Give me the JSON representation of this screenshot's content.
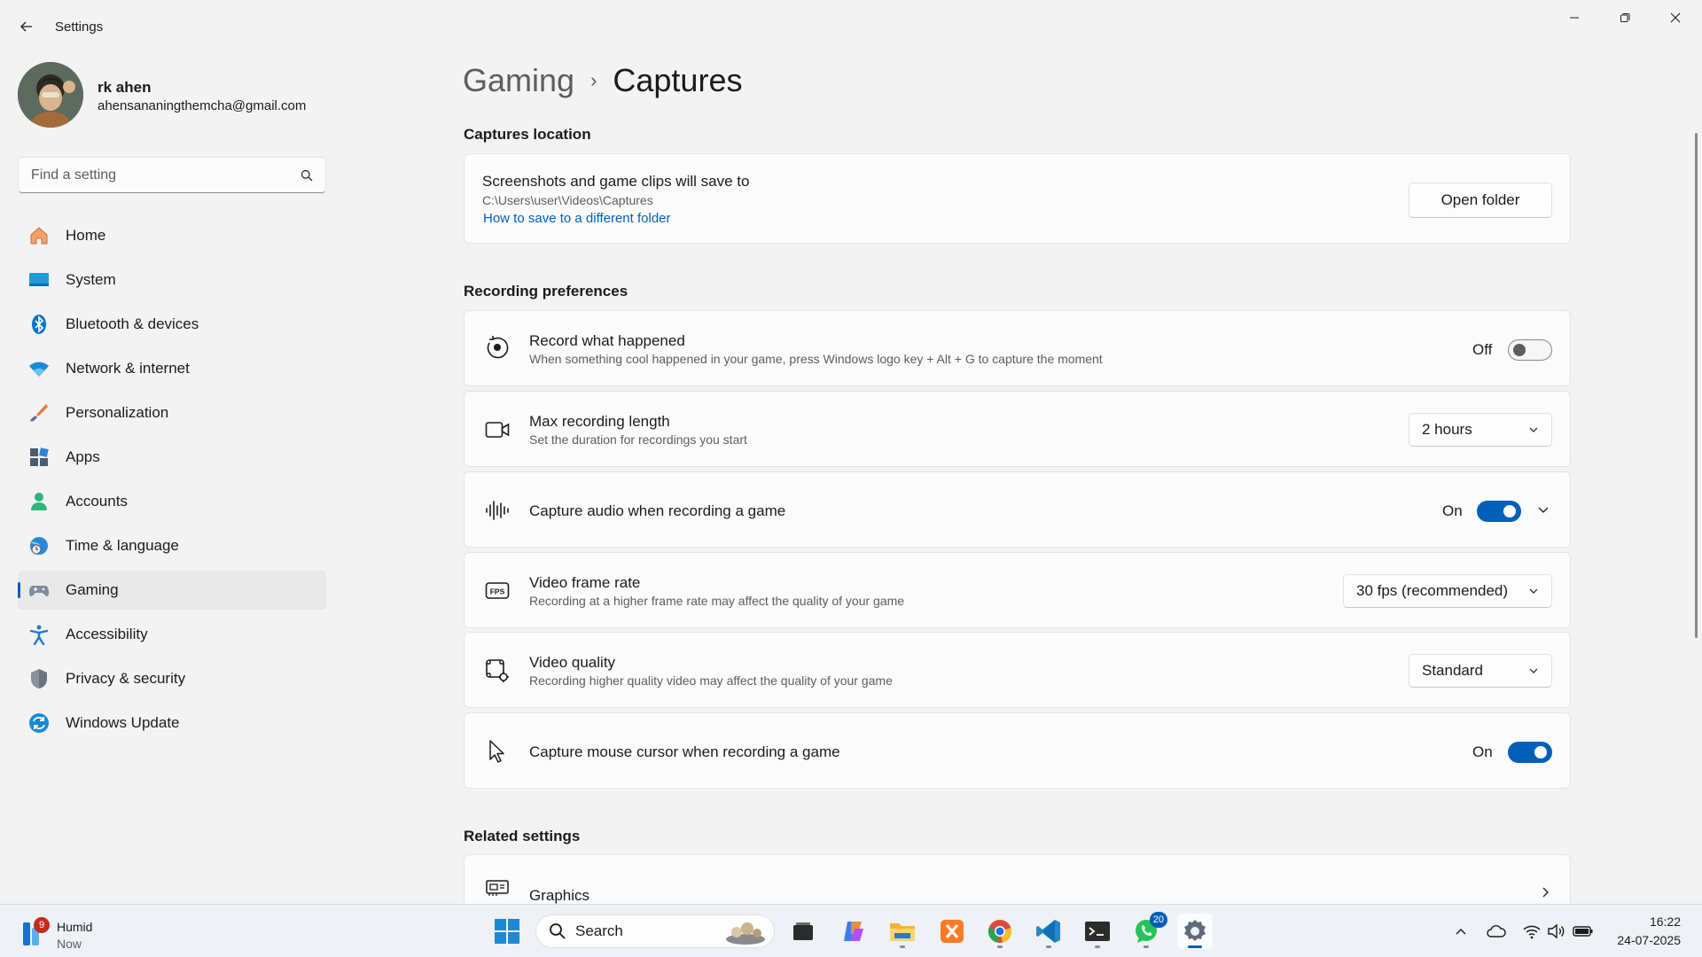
{
  "window": {
    "app_title": "Settings"
  },
  "profile": {
    "name": "rk ahen",
    "email": "ahensananingthemcha@gmail.com"
  },
  "search": {
    "placeholder": "Find a setting"
  },
  "nav": {
    "items": [
      {
        "label": "Home",
        "icon": "home-icon"
      },
      {
        "label": "System",
        "icon": "system-icon"
      },
      {
        "label": "Bluetooth & devices",
        "icon": "bluetooth-icon"
      },
      {
        "label": "Network & internet",
        "icon": "wifi-icon"
      },
      {
        "label": "Personalization",
        "icon": "brush-icon"
      },
      {
        "label": "Apps",
        "icon": "apps-icon"
      },
      {
        "label": "Accounts",
        "icon": "person-icon"
      },
      {
        "label": "Time & language",
        "icon": "globe-clock-icon"
      },
      {
        "label": "Gaming",
        "icon": "gamepad-icon",
        "active": true
      },
      {
        "label": "Accessibility",
        "icon": "accessibility-icon"
      },
      {
        "label": "Privacy & security",
        "icon": "shield-icon"
      },
      {
        "label": "Windows Update",
        "icon": "update-icon"
      }
    ]
  },
  "breadcrumb": {
    "parent": "Gaming",
    "separator": "›",
    "current": "Captures"
  },
  "captures_location": {
    "section_title": "Captures location",
    "title": "Screenshots and game clips will save to",
    "path": "C:\\Users\\user\\Videos\\Captures",
    "link": "How to save to a different folder",
    "button": "Open folder"
  },
  "recording_preferences": {
    "section_title": "Recording preferences",
    "record_what_happened": {
      "title": "Record what happened",
      "desc": "When something cool happened in your game, press Windows logo key + Alt + G to capture the moment",
      "state_label": "Off",
      "on": false
    },
    "max_recording_length": {
      "title": "Max recording length",
      "desc": "Set the duration for recordings you start",
      "value": "2 hours"
    },
    "capture_audio": {
      "title": "Capture audio when recording a game",
      "state_label": "On",
      "on": true
    },
    "video_frame_rate": {
      "title": "Video frame rate",
      "desc": "Recording at a higher frame rate may affect the quality of your game",
      "value": "30 fps (recommended)"
    },
    "video_quality": {
      "title": "Video quality",
      "desc": "Recording higher quality video may affect the quality of your game",
      "value": "Standard"
    },
    "capture_mouse_cursor": {
      "title": "Capture mouse cursor when recording a game",
      "state_label": "On",
      "on": true
    }
  },
  "related_settings": {
    "section_title": "Related settings",
    "graphics": "Graphics"
  },
  "taskbar": {
    "weather_name": "Humid",
    "weather_time": "Now",
    "weather_badge": "9",
    "search_label": "Search",
    "whatsapp_badge": "20",
    "time": "16:22",
    "date": "24-07-2025"
  },
  "colors": {
    "accent": "#005fb8",
    "background": "#f3f3f3",
    "card": "#fbfbfb"
  }
}
